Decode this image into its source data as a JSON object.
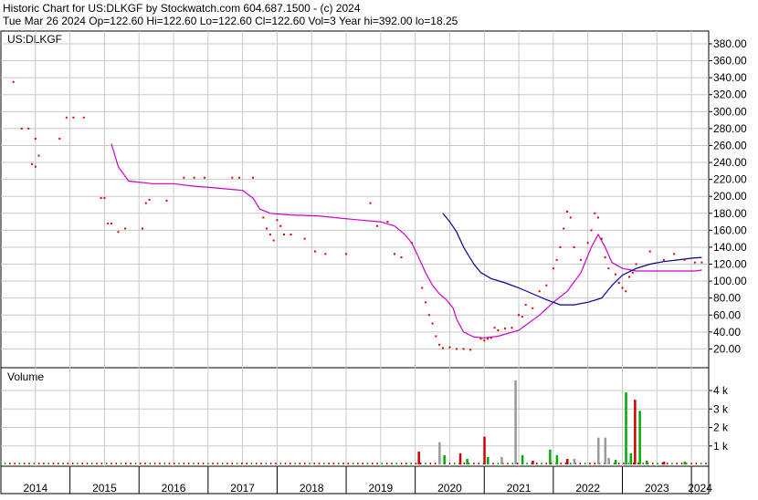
{
  "header": {
    "line1": "Historic Chart for US:DLKGF by Stockwatch.com 604.687.1500 - (c) 2024",
    "line2": "Tue Mar 26 2024   Op=122.60   Hi=122.60   Lo=122.60   Cl=122.60   Vol=3   Year hi=392.00   lo=18.25"
  },
  "price_panel": {
    "symbol_label": "US:DLKGF"
  },
  "volume_panel": {
    "label": "Volume"
  },
  "colors": {
    "background": "#ffffff",
    "grid": "#c8c8c8",
    "price_dot": "#dd0000",
    "ma_long": "#000099",
    "ma_short": "#cc00cc",
    "vol_up": "#00aa00",
    "vol_down": "#cc0000",
    "vol_flat": "#999999"
  },
  "chart_data": [
    {
      "type": "scatter",
      "title": "US:DLKGF",
      "x_axis_ticks": [
        "2014",
        "2015",
        "2016",
        "2017",
        "2018",
        "2019",
        "2020",
        "2021",
        "2022",
        "2023",
        "2024"
      ],
      "y_ticks": [
        "20.00",
        "40.00",
        "60.00",
        "80.00",
        "100.00",
        "120.00",
        "140.00",
        "160.00",
        "180.00",
        "200.00",
        "220.00",
        "240.00",
        "260.00",
        "280.00",
        "300.00",
        "320.00",
        "340.00",
        "360.00",
        "380.00"
      ],
      "ylim": [
        0,
        392
      ],
      "xlim": [
        2014.0,
        2024.25
      ],
      "grid": true,
      "series": [
        {
          "style": "dots",
          "points": [
            [
              2014.18,
              335
            ],
            [
              2014.3,
              280
            ],
            [
              2014.4,
              280
            ],
            [
              2014.45,
              238
            ],
            [
              2014.5,
              235
            ],
            [
              2014.55,
              248
            ],
            [
              2014.5,
              268
            ],
            [
              2014.85,
              268
            ],
            [
              2014.95,
              293
            ],
            [
              2015.05,
              293
            ],
            [
              2015.2,
              293
            ],
            [
              2015.45,
              198
            ],
            [
              2015.5,
              198
            ],
            [
              2015.55,
              168
            ],
            [
              2015.6,
              168
            ],
            [
              2015.7,
              158
            ],
            [
              2015.8,
              162
            ],
            [
              2016.05,
              162
            ],
            [
              2016.1,
              192
            ],
            [
              2016.15,
              196
            ],
            [
              2016.4,
              195
            ],
            [
              2016.65,
              222
            ],
            [
              2016.8,
              222
            ],
            [
              2016.95,
              222
            ],
            [
              2017.35,
              222
            ],
            [
              2017.45,
              222
            ],
            [
              2017.65,
              222
            ],
            [
              2017.8,
              175
            ],
            [
              2017.85,
              162
            ],
            [
              2017.9,
              155
            ],
            [
              2017.95,
              148
            ],
            [
              2018.0,
              172
            ],
            [
              2018.05,
              165
            ],
            [
              2018.1,
              155
            ],
            [
              2018.2,
              155
            ],
            [
              2018.4,
              150
            ],
            [
              2018.55,
              135
            ],
            [
              2018.7,
              132
            ],
            [
              2019.0,
              132
            ],
            [
              2019.35,
              192
            ],
            [
              2019.45,
              165
            ],
            [
              2019.6,
              170
            ],
            [
              2019.7,
              132
            ],
            [
              2019.8,
              128
            ],
            [
              2019.95,
              145
            ],
            [
              2020.1,
              92
            ],
            [
              2020.15,
              75
            ],
            [
              2020.2,
              60
            ],
            [
              2020.25,
              50
            ],
            [
              2020.3,
              35
            ],
            [
              2020.35,
              25
            ],
            [
              2020.4,
              21
            ],
            [
              2020.5,
              22
            ],
            [
              2020.6,
              20
            ],
            [
              2020.7,
              20
            ],
            [
              2020.8,
              19
            ],
            [
              2020.95,
              32
            ],
            [
              2021.0,
              30
            ],
            [
              2021.05,
              32
            ],
            [
              2021.1,
              33
            ],
            [
              2021.15,
              45
            ],
            [
              2021.2,
              42
            ],
            [
              2021.3,
              44
            ],
            [
              2021.4,
              45
            ],
            [
              2021.5,
              60
            ],
            [
              2021.55,
              58
            ],
            [
              2021.6,
              72
            ],
            [
              2021.7,
              68
            ],
            [
              2021.8,
              88
            ],
            [
              2021.9,
              95
            ],
            [
              2022.0,
              115
            ],
            [
              2022.05,
              125
            ],
            [
              2022.1,
              140
            ],
            [
              2022.15,
              162
            ],
            [
              2022.2,
              182
            ],
            [
              2022.25,
              175
            ],
            [
              2022.3,
              140
            ],
            [
              2022.4,
              125
            ],
            [
              2022.5,
              145
            ],
            [
              2022.55,
              160
            ],
            [
              2022.6,
              180
            ],
            [
              2022.65,
              175
            ],
            [
              2022.7,
              150
            ],
            [
              2022.75,
              128
            ],
            [
              2022.8,
              115
            ],
            [
              2022.9,
              108
            ],
            [
              2022.95,
              98
            ],
            [
              2023.0,
              92
            ],
            [
              2023.05,
              88
            ],
            [
              2023.1,
              105
            ],
            [
              2023.15,
              110
            ],
            [
              2023.2,
              120
            ],
            [
              2023.4,
              135
            ],
            [
              2023.6,
              125
            ],
            [
              2023.75,
              132
            ],
            [
              2023.9,
              125
            ],
            [
              2024.05,
              122
            ],
            [
              2024.15,
              122
            ]
          ]
        },
        {
          "style": "line",
          "color_key": "ma_short",
          "points": [
            [
              2015.6,
              262
            ],
            [
              2015.7,
              235
            ],
            [
              2015.85,
              218
            ],
            [
              2016.2,
              215
            ],
            [
              2016.5,
              215
            ],
            [
              2016.8,
              212
            ],
            [
              2017.1,
              210
            ],
            [
              2017.5,
              207
            ],
            [
              2017.65,
              198
            ],
            [
              2017.75,
              185
            ],
            [
              2017.9,
              180
            ],
            [
              2018.2,
              178
            ],
            [
              2018.6,
              177
            ],
            [
              2018.95,
              174
            ],
            [
              2019.2,
              172
            ],
            [
              2019.5,
              170
            ],
            [
              2019.7,
              165
            ],
            [
              2019.85,
              155
            ],
            [
              2019.95,
              145
            ],
            [
              2020.05,
              128
            ],
            [
              2020.15,
              110
            ],
            [
              2020.25,
              95
            ],
            [
              2020.35,
              85
            ],
            [
              2020.45,
              78
            ],
            [
              2020.55,
              68
            ],
            [
              2020.6,
              55
            ],
            [
              2020.7,
              40
            ],
            [
              2020.85,
              34
            ],
            [
              2021.0,
              33
            ],
            [
              2021.2,
              35
            ],
            [
              2021.5,
              42
            ],
            [
              2021.8,
              60
            ],
            [
              2022.0,
              75
            ],
            [
              2022.2,
              88
            ],
            [
              2022.4,
              110
            ],
            [
              2022.55,
              140
            ],
            [
              2022.65,
              155
            ],
            [
              2022.75,
              140
            ],
            [
              2022.85,
              122
            ],
            [
              2023.0,
              115
            ],
            [
              2023.2,
              112
            ],
            [
              2023.5,
              112
            ],
            [
              2023.8,
              112
            ],
            [
              2024.05,
              112
            ],
            [
              2024.15,
              113
            ]
          ]
        },
        {
          "style": "line",
          "color_key": "ma_long",
          "points": [
            [
              2020.4,
              180
            ],
            [
              2020.5,
              170
            ],
            [
              2020.6,
              158
            ],
            [
              2020.7,
              140
            ],
            [
              2020.85,
              120
            ],
            [
              2020.95,
              110
            ],
            [
              2021.1,
              103
            ],
            [
              2021.3,
              98
            ],
            [
              2021.5,
              92
            ],
            [
              2021.7,
              85
            ],
            [
              2021.9,
              78
            ],
            [
              2022.1,
              72
            ],
            [
              2022.3,
              72
            ],
            [
              2022.5,
              75
            ],
            [
              2022.7,
              80
            ],
            [
              2022.85,
              95
            ],
            [
              2023.0,
              107
            ],
            [
              2023.2,
              115
            ],
            [
              2023.4,
              120
            ],
            [
              2023.6,
              123
            ],
            [
              2023.8,
              125
            ],
            [
              2024.0,
              127
            ],
            [
              2024.15,
              128
            ]
          ]
        }
      ]
    },
    {
      "type": "bar",
      "title": "Volume",
      "y_ticks": [
        "1 k",
        "2 k",
        "3 k",
        "4 k"
      ],
      "ylim": [
        0,
        4.6
      ],
      "grid": true,
      "bars": [
        {
          "x": 2020.05,
          "value": 0.7,
          "color_key": "vol_down"
        },
        {
          "x": 2020.35,
          "value": 1.2,
          "color_key": "vol_flat"
        },
        {
          "x": 2020.42,
          "value": 0.5,
          "color_key": "vol_up"
        },
        {
          "x": 2020.65,
          "value": 0.6,
          "color_key": "vol_down"
        },
        {
          "x": 2020.75,
          "value": 0.3,
          "color_key": "vol_up"
        },
        {
          "x": 2021.0,
          "value": 1.5,
          "color_key": "vol_down"
        },
        {
          "x": 2021.05,
          "value": 0.4,
          "color_key": "vol_up"
        },
        {
          "x": 2021.25,
          "value": 0.4,
          "color_key": "vol_flat"
        },
        {
          "x": 2021.45,
          "value": 4.55,
          "color_key": "vol_flat"
        },
        {
          "x": 2021.55,
          "value": 0.5,
          "color_key": "vol_up"
        },
        {
          "x": 2021.7,
          "value": 0.2,
          "color_key": "vol_down"
        },
        {
          "x": 2021.95,
          "value": 0.8,
          "color_key": "vol_up"
        },
        {
          "x": 2022.05,
          "value": 0.5,
          "color_key": "vol_up"
        },
        {
          "x": 2022.2,
          "value": 0.3,
          "color_key": "vol_down"
        },
        {
          "x": 2022.3,
          "value": 0.3,
          "color_key": "vol_flat"
        },
        {
          "x": 2022.65,
          "value": 1.45,
          "color_key": "vol_flat"
        },
        {
          "x": 2022.75,
          "value": 1.45,
          "color_key": "vol_flat"
        },
        {
          "x": 2022.8,
          "value": 0.35,
          "color_key": "vol_flat"
        },
        {
          "x": 2022.9,
          "value": 0.25,
          "color_key": "vol_up"
        },
        {
          "x": 2023.05,
          "value": 3.9,
          "color_key": "vol_up"
        },
        {
          "x": 2023.12,
          "value": 0.6,
          "color_key": "vol_up"
        },
        {
          "x": 2023.18,
          "value": 3.5,
          "color_key": "vol_down"
        },
        {
          "x": 2023.25,
          "value": 2.9,
          "color_key": "vol_up"
        },
        {
          "x": 2023.35,
          "value": 0.2,
          "color_key": "vol_up"
        },
        {
          "x": 2023.6,
          "value": 0.15,
          "color_key": "vol_down"
        },
        {
          "x": 2023.9,
          "value": 0.15,
          "color_key": "vol_up"
        }
      ]
    }
  ]
}
